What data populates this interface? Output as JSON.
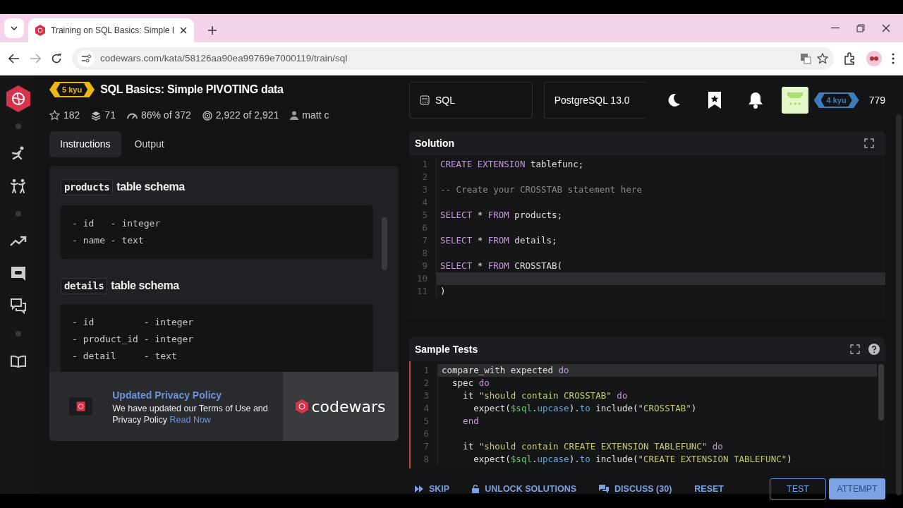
{
  "browser": {
    "tab_title": "Training on SQL Basics: Simple I",
    "address": "codewars.com/kata/58126aa90ea99769e7000119/train/sql"
  },
  "kata": {
    "rank": "5 kyu",
    "title": "SQL Basics: Simple PIVOTING data",
    "stats": [
      {
        "kind": "stars",
        "text": "182"
      },
      {
        "kind": "collections",
        "text": "71"
      },
      {
        "kind": "satisfaction",
        "text": "86% of 372"
      },
      {
        "kind": "completed",
        "text": "2,922 of 2,921"
      },
      {
        "kind": "author",
        "text": "matt c"
      }
    ]
  },
  "tabs": [
    {
      "label": "Instructions",
      "selected": true
    },
    {
      "label": "Output",
      "selected": false
    }
  ],
  "instructions": [
    {
      "table": "products",
      "heading": "table schema",
      "lines": [
        "- id   - integer",
        "- name - text"
      ]
    },
    {
      "table": "details",
      "heading": "table schema",
      "lines": [
        "- id         - integer",
        "- product_id - integer",
        "- detail     - text"
      ]
    }
  ],
  "banner": {
    "title": "Updated Privacy Policy",
    "text": "We have updated our Terms of Use and Privacy Policy",
    "link": "Read Now",
    "brand": "codewars"
  },
  "toolbar": {
    "language": "SQL",
    "version": "PostgreSQL 13.0",
    "rank": "4 kyu",
    "honor": "779"
  },
  "solution": {
    "title": "Solution",
    "lines": [
      {
        "number": "1",
        "current": false,
        "tokens": [
          {
            "kind": "keyword",
            "text": "CREATE EXTENSION"
          },
          {
            "kind": "plain",
            "text": " tablefunc;"
          }
        ]
      },
      {
        "number": "2",
        "current": false
      },
      {
        "number": "3",
        "current": false,
        "tokens": [
          {
            "kind": "comment",
            "text": "-- Create your CROSSTAB statement here"
          }
        ]
      },
      {
        "number": "4",
        "current": false
      },
      {
        "number": "5",
        "current": false,
        "tokens": [
          {
            "kind": "keyword",
            "text": "SELECT"
          },
          {
            "kind": "plain",
            "text": " * "
          },
          {
            "kind": "keyword",
            "text": "FROM"
          },
          {
            "kind": "plain",
            "text": " products;"
          }
        ]
      },
      {
        "number": "6",
        "current": false
      },
      {
        "number": "7",
        "current": false,
        "tokens": [
          {
            "kind": "keyword",
            "text": "SELECT"
          },
          {
            "kind": "plain",
            "text": " * "
          },
          {
            "kind": "keyword",
            "text": "FROM"
          },
          {
            "kind": "plain",
            "text": " details;"
          }
        ]
      },
      {
        "number": "8",
        "current": false
      },
      {
        "number": "9",
        "current": false,
        "tokens": [
          {
            "kind": "keyword",
            "text": "SELECT"
          },
          {
            "kind": "plain",
            "text": " * "
          },
          {
            "kind": "keyword",
            "text": "FROM"
          },
          {
            "kind": "plain",
            "text": " CROSSTAB("
          }
        ]
      },
      {
        "number": "10",
        "current": true
      },
      {
        "number": "11",
        "current": false,
        "tokens": [
          {
            "kind": "plain",
            "text": ")"
          }
        ]
      }
    ]
  },
  "tests": {
    "title": "Sample Tests",
    "lines": [
      {
        "number": "1",
        "current": true,
        "tokens": [
          {
            "kind": "plain",
            "text": "compare_with expected "
          },
          {
            "kind": "keyword",
            "text": "do"
          }
        ]
      },
      {
        "number": "2",
        "current": false,
        "tokens": [
          {
            "kind": "plain",
            "text": "  spec "
          },
          {
            "kind": "keyword",
            "text": "do"
          }
        ]
      },
      {
        "number": "3",
        "current": false,
        "tokens": [
          {
            "kind": "plain",
            "text": "    it "
          },
          {
            "kind": "string",
            "text": "\"should contain CROSSTAB\""
          },
          {
            "kind": "keyword",
            "text": " do"
          }
        ]
      },
      {
        "number": "4",
        "current": false,
        "tokens": [
          {
            "kind": "plain",
            "text": "      expect("
          },
          {
            "kind": "variable",
            "text": "$sql"
          },
          {
            "kind": "plain",
            "text": "."
          },
          {
            "kind": "method",
            "text": "upcase"
          },
          {
            "kind": "plain",
            "text": ")."
          },
          {
            "kind": "method",
            "text": "to"
          },
          {
            "kind": "plain",
            "text": " include("
          },
          {
            "kind": "string",
            "text": "\"CROSSTAB\""
          },
          {
            "kind": "plain",
            "text": ")"
          }
        ]
      },
      {
        "number": "5",
        "current": false,
        "tokens": [
          {
            "kind": "keyword",
            "text": "    end"
          }
        ]
      },
      {
        "number": "6",
        "current": false
      },
      {
        "number": "7",
        "current": false,
        "tokens": [
          {
            "kind": "plain",
            "text": "    it "
          },
          {
            "kind": "string",
            "text": "\"should contain CREATE EXTENSION TABLEFUNC\""
          },
          {
            "kind": "keyword",
            "text": " do"
          }
        ]
      },
      {
        "number": "8",
        "current": false,
        "tokens": [
          {
            "kind": "plain",
            "text": "      expect("
          },
          {
            "kind": "variable",
            "text": "$sql"
          },
          {
            "kind": "plain",
            "text": "."
          },
          {
            "kind": "method",
            "text": "upcase"
          },
          {
            "kind": "plain",
            "text": ")."
          },
          {
            "kind": "method",
            "text": "to"
          },
          {
            "kind": "plain",
            "text": " include("
          },
          {
            "kind": "string",
            "text": "\"CREATE EXTENSION TABLEFUNC\""
          },
          {
            "kind": "plain",
            "text": ")"
          }
        ]
      }
    ]
  },
  "actions": [
    {
      "kind": "skip",
      "label": "SKIP"
    },
    {
      "kind": "unlock",
      "label": "UNLOCK SOLUTIONS"
    },
    {
      "kind": "discuss",
      "label": "DISCUSS (30)"
    },
    {
      "kind": "reset",
      "label": "RESET"
    }
  ],
  "buttons": [
    {
      "kind": "outline",
      "label": "TEST"
    },
    {
      "kind": "primary",
      "label": "ATTEMPT"
    }
  ]
}
